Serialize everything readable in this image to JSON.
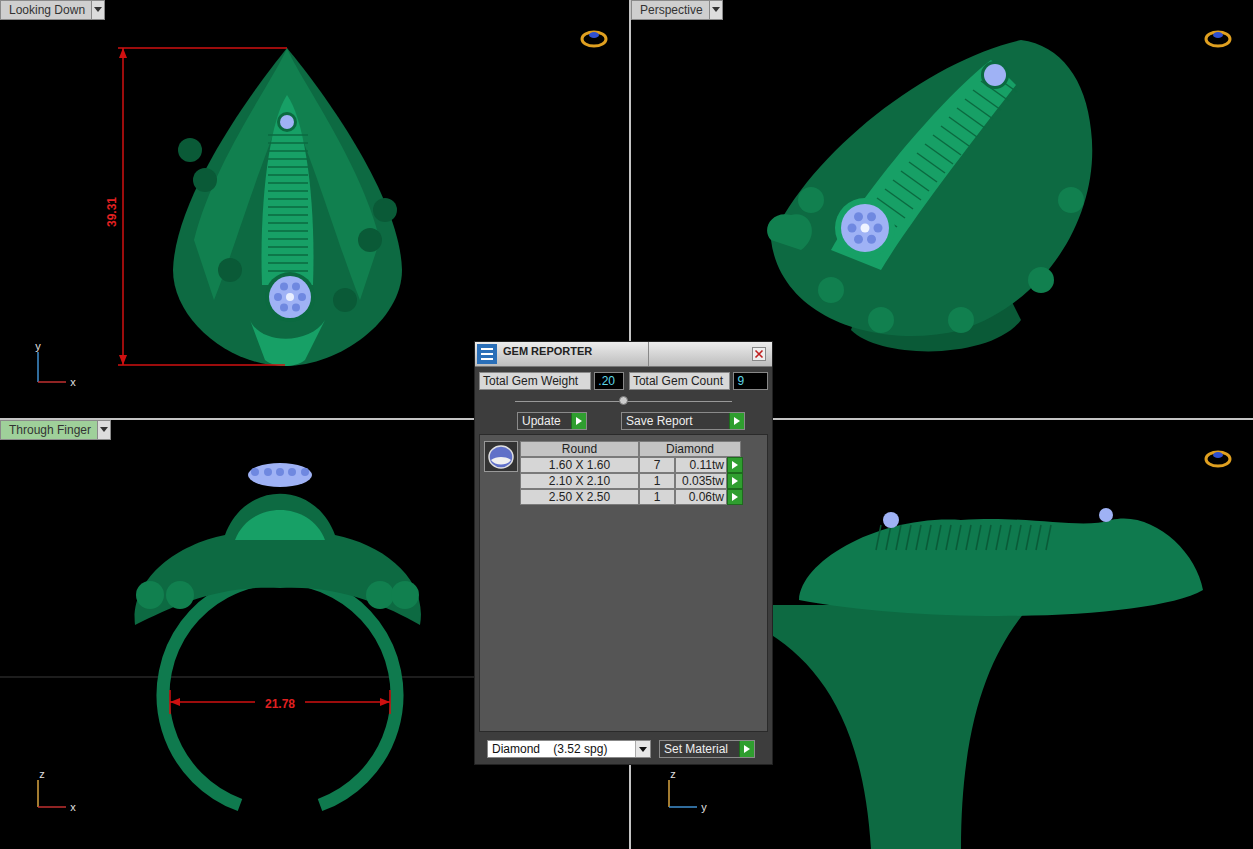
{
  "viewports": [
    {
      "kind": "top",
      "label": "Looking Down",
      "selected": false,
      "dimension": "39.31",
      "axes": [
        "y",
        "x"
      ]
    },
    {
      "kind": "perspective",
      "label": "Perspective",
      "selected": false,
      "axes": []
    },
    {
      "kind": "front",
      "label": "Through Finger",
      "selected": true,
      "dimension": "21.78",
      "axes": [
        "z",
        "x"
      ]
    },
    {
      "kind": "side",
      "selected": false,
      "axes": [
        "z",
        "y"
      ]
    }
  ],
  "gem_reporter": {
    "title": "GEM REPORTER",
    "total_weight_label": "Total Gem Weight",
    "total_weight": ".20",
    "total_count_label": "Total Gem Count",
    "total_count": "9",
    "buttons": [
      "Update",
      "Save Report"
    ],
    "table": {
      "columns": [
        "Round",
        "Diamond"
      ],
      "rows": [
        {
          "size": "1.60 X 1.60",
          "count": "7",
          "weight": "0.11tw"
        },
        {
          "size": "2.10 X 2.10",
          "count": "1",
          "weight": "0.035tw"
        },
        {
          "size": "2.50 X 2.50",
          "count": "1",
          "weight": "0.06tw"
        }
      ]
    },
    "material": "Diamond    (3.52 spg)",
    "set_material": "Set Material"
  }
}
